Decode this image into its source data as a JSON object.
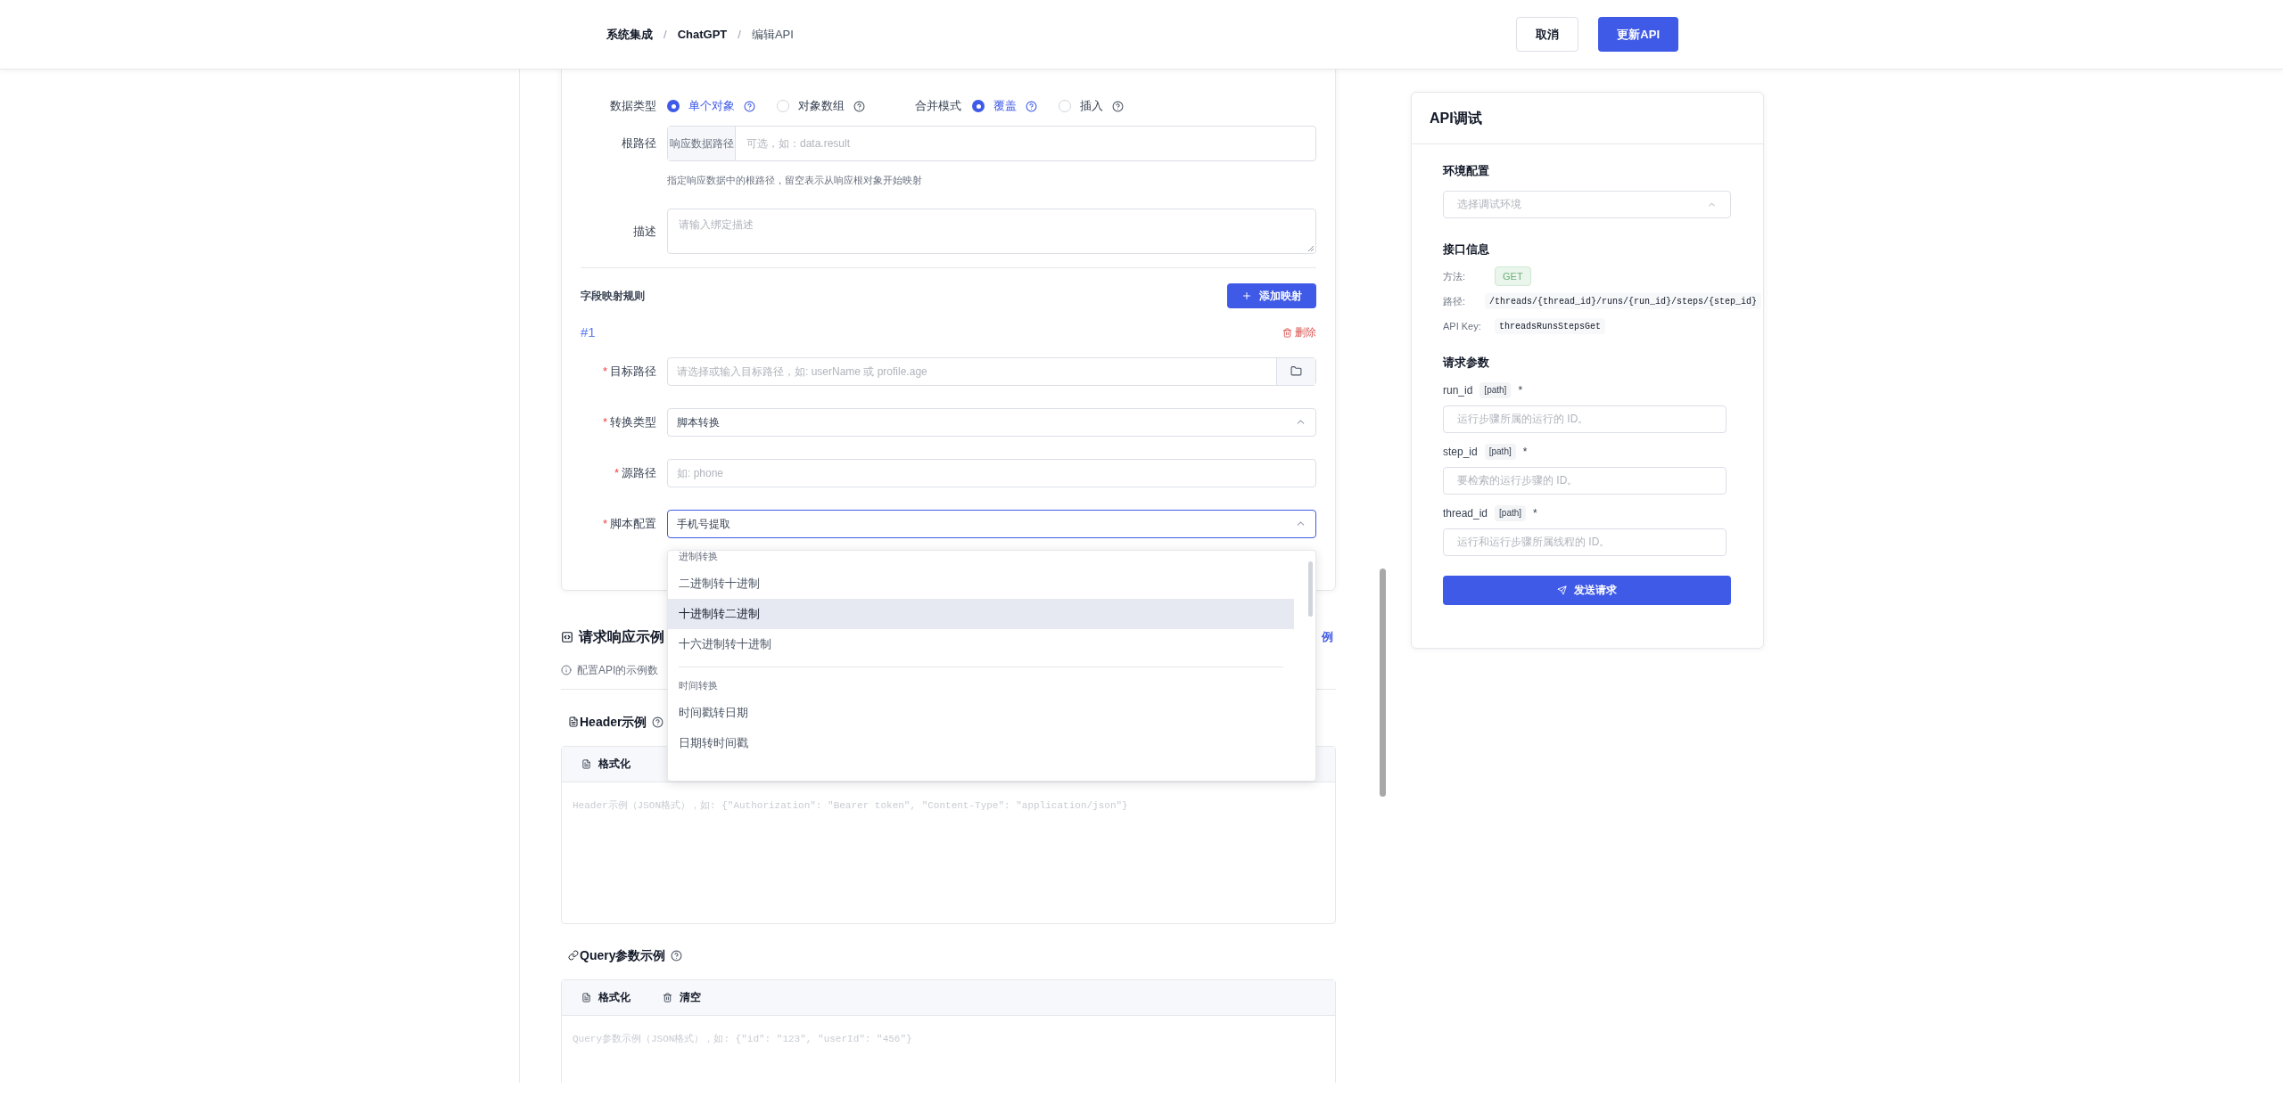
{
  "breadcrumb": {
    "separator": "/",
    "items": [
      {
        "label": "系统集成",
        "current": false
      },
      {
        "label": "ChatGPT",
        "current": false
      },
      {
        "label": "编辑API",
        "current": true
      }
    ]
  },
  "header_buttons": [
    {
      "label": "取消",
      "kind": "secondary"
    },
    {
      "label": "更新API",
      "kind": "primary"
    }
  ],
  "binding_form": {
    "radio_groups": [
      {
        "label": "数据类型",
        "options": [
          {
            "label": "单个对象",
            "selected": true
          },
          {
            "label": "对象数组",
            "selected": false
          }
        ]
      },
      {
        "label": "合并模式",
        "options": [
          {
            "label": "覆盖",
            "selected": true
          },
          {
            "label": "插入",
            "selected": false
          }
        ]
      }
    ],
    "root_path": {
      "label": "根路径",
      "addon": "响应数据路径",
      "placeholder": "可选，如：data.result",
      "hint": "指定响应数据中的根路径，留空表示从响应根对象开始映射"
    },
    "description": {
      "label": "描述",
      "placeholder": "请输入绑定描述"
    },
    "mapping_title": "字段映射规则",
    "add_button": "添加映射",
    "mapping": {
      "index": "#1",
      "delete": "删除",
      "required_mark": "*",
      "fields": [
        {
          "label": "目标路径",
          "required": true,
          "kind": "browse",
          "placeholder": "请选择或输入目标路径，如: userName 或 profile.age"
        },
        {
          "label": "转换类型",
          "required": true,
          "kind": "select",
          "value": "脚本转换",
          "focused": false
        },
        {
          "label": "源路径",
          "required": true,
          "kind": "input",
          "placeholder": "如: phone"
        },
        {
          "label": "脚本配置",
          "required": true,
          "kind": "select",
          "value": "手机号提取",
          "focused": true
        }
      ]
    }
  },
  "script_dropdown": {
    "groups": [
      {
        "label": "进制转换",
        "items": [
          {
            "label": "二进制转十进制",
            "highlighted": false
          },
          {
            "label": "十进制转二进制",
            "highlighted": true
          },
          {
            "label": "十六进制转十进制",
            "highlighted": false
          }
        ]
      },
      {
        "label": "时间转换",
        "items": [
          {
            "label": "时间戳转日期",
            "highlighted": false
          },
          {
            "label": "日期转时间戳",
            "highlighted": false
          }
        ]
      }
    ]
  },
  "examples": {
    "title": "请求响应示例",
    "link": "例",
    "hint": "配置API的示例数",
    "editors": [
      {
        "kind": "header",
        "title": "Header示例",
        "tools": [
          {
            "kind": "format",
            "label": "格式化"
          }
        ],
        "placeholder": "Header示例（JSON格式），如: {\"Authorization\": \"Bearer token\", \"Content-Type\": \"application/json\"}"
      },
      {
        "kind": "query",
        "title": "Query参数示例",
        "tools": [
          {
            "kind": "format",
            "label": "格式化"
          },
          {
            "kind": "clear",
            "label": "清空"
          }
        ],
        "placeholder": "Query参数示例（JSON格式），如: {\"id\": \"123\", \"userId\": \"456\"}"
      }
    ]
  },
  "debug_panel": {
    "title": "API调试",
    "env": {
      "label": "环境配置",
      "placeholder": "选择调试环境"
    },
    "info": {
      "label": "接口信息",
      "rows": [
        {
          "kind": "badge",
          "label": "方法:",
          "value": "GET"
        },
        {
          "kind": "code",
          "label": "路径:",
          "value": "/threads/{thread_id}/runs/{run_id}/steps/{step_id}"
        },
        {
          "kind": "code",
          "label": "API Key:",
          "value": "threadsRunsStepsGet"
        }
      ]
    },
    "params": {
      "label": "请求参数",
      "required_mark": "*",
      "items": [
        {
          "name": "run_id",
          "location": "[path]",
          "required": true,
          "placeholder": "运行步骤所属的运行的 ID。"
        },
        {
          "name": "step_id",
          "location": "[path]",
          "required": true,
          "placeholder": "要检索的运行步骤的 ID。"
        },
        {
          "name": "thread_id",
          "location": "[path]",
          "required": true,
          "placeholder": "运行和运行步骤所属线程的 ID。"
        }
      ]
    },
    "send_button": "发送请求"
  }
}
